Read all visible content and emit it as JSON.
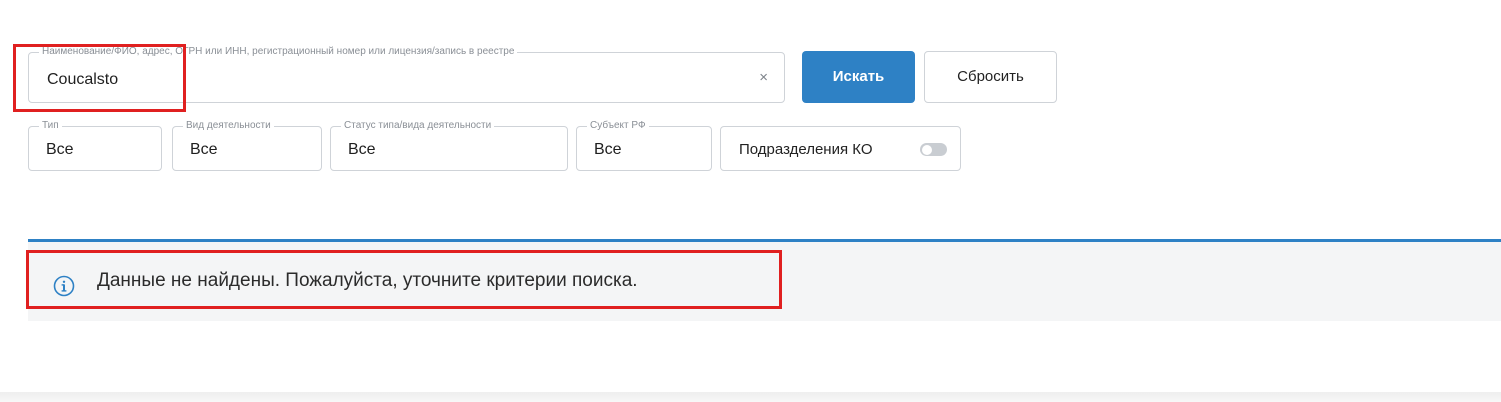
{
  "search": {
    "legend": "Наименование/ФИО, адрес, ОГРН или ИНН, регистрационный номер или лицензия/запись в реестре",
    "value": "Coucalsto",
    "clear_glyph": "×"
  },
  "buttons": {
    "search_label": "Искать",
    "reset_label": "Сбросить"
  },
  "filters": {
    "type": {
      "legend": "Тип",
      "value": "Все"
    },
    "activity": {
      "legend": "Вид деятельности",
      "value": "Все"
    },
    "status": {
      "legend": "Статус типа/вида деятельности",
      "value": "Все"
    },
    "subject": {
      "legend": "Субъект РФ",
      "value": "Все"
    },
    "branches": {
      "label": "Подразделения КО",
      "enabled": false
    }
  },
  "notice": {
    "icon": "info-icon",
    "text": "Данные не найдены. Пожалуйста, уточните критерии поиска."
  },
  "colors": {
    "accent": "#2e81c5",
    "highlight": "#e02020",
    "panel": "#f4f5f6"
  }
}
